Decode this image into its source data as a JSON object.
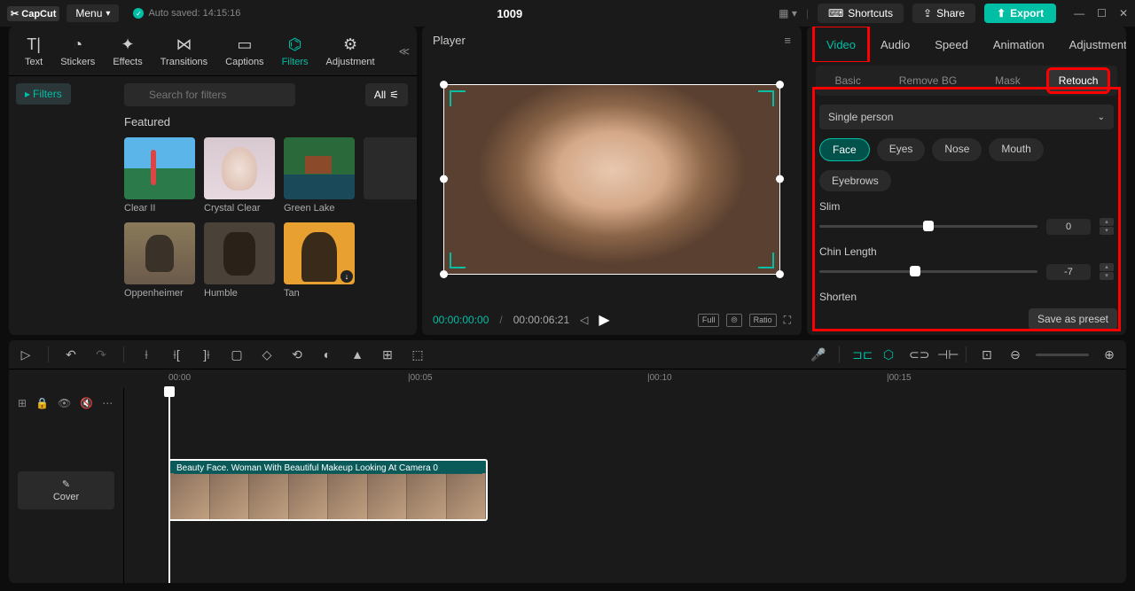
{
  "titlebar": {
    "logo": "✂ CapCut",
    "menu": "Menu",
    "autosave": "Auto saved: 14:15:16",
    "project": "1009",
    "shortcuts": "Shortcuts",
    "share": "Share",
    "export": "Export"
  },
  "left_tabs": [
    "Text",
    "Stickers",
    "Effects",
    "Transitions",
    "Captions",
    "Filters",
    "Adjustment"
  ],
  "left_tabs_active": 5,
  "filters_chip": "Filters",
  "search_placeholder": "Search for filters",
  "all_btn": "All",
  "featured_title": "Featured",
  "thumbs": [
    {
      "label": "Clear II"
    },
    {
      "label": "Crystal Clear"
    },
    {
      "label": "Green Lake"
    },
    {
      "label": ""
    },
    {
      "label": "Oppenheimer"
    },
    {
      "label": "Humble"
    },
    {
      "label": "Tan"
    }
  ],
  "player": {
    "title": "Player",
    "time_current": "00:00:00:00",
    "time_total": "00:00:06:21",
    "full": "Full",
    "ratio": "Ratio"
  },
  "right_tabs": [
    "Video",
    "Audio",
    "Speed",
    "Animation",
    "Adjustment"
  ],
  "right_tabs_active": 0,
  "sub_tabs": [
    "Basic",
    "Remove BG",
    "Mask",
    "Retouch"
  ],
  "sub_tabs_active": 3,
  "dropdown": "Single person",
  "pills": [
    "Face",
    "Eyes",
    "Nose",
    "Mouth",
    "Eyebrows"
  ],
  "pills_active": 0,
  "sliders": [
    {
      "label": "Slim",
      "value": "0",
      "pos": 50
    },
    {
      "label": "Chin Length",
      "value": "-7",
      "pos": 44
    },
    {
      "label": "Shorten",
      "value": "",
      "pos": 0
    }
  ],
  "save_preset": "Save as preset",
  "timeline": {
    "marks": [
      "00:00",
      "|00:05",
      "|00:10",
      "|00:15"
    ],
    "clip_title": "Beauty Face. Woman With Beautiful Makeup Looking At Camera   0",
    "cover": "Cover"
  }
}
